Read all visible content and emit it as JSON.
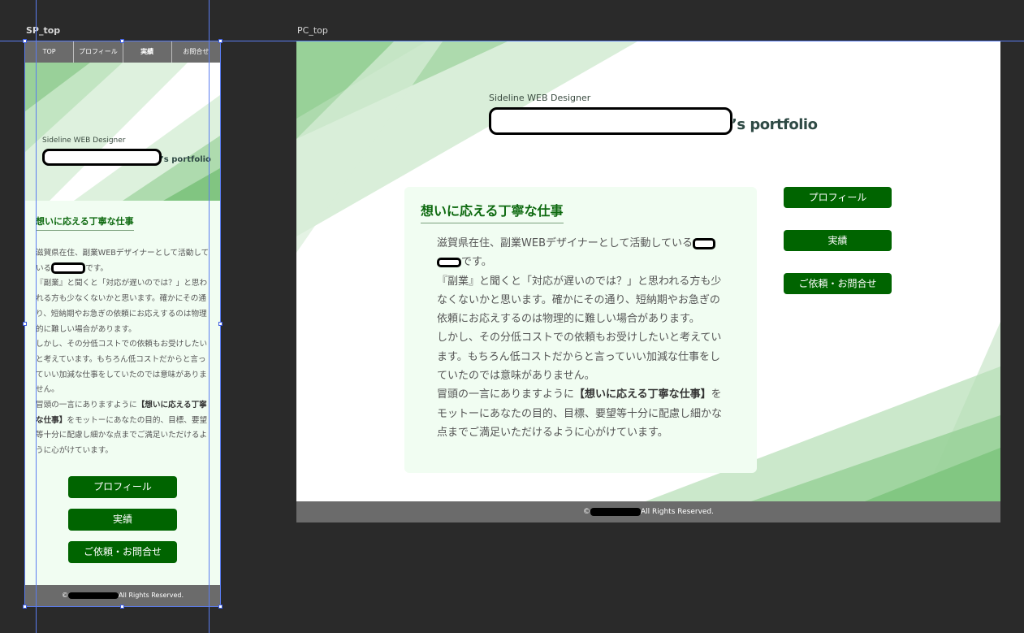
{
  "artboards": {
    "sp_label": "SP_top",
    "pc_label": "PC_top"
  },
  "sp": {
    "nav": [
      "TOP",
      "プロフィール",
      "実績",
      "お問合せ"
    ],
    "tagline": "Sideline WEB Designer",
    "portfolio_suffix": "’s portfolio",
    "heading": "想いに応える丁寧な仕事",
    "body_p1": "滋賀県在住、副業WEBデザイナーとして活動している",
    "body_p1_end": "です。",
    "body_p2": "『副業』と聞くと「対応が遅いのでは？」と思われる方も少なくないかと思います。確かにその通り、短納期やお急ぎの依頼にお応えするのは物理的に難しい場合があります。",
    "body_p3": "しかし、その分低コストでの依頼もお受けしたいと考えています。もちろん低コストだからと言っていい加減な仕事をしていたのでは意味がありません。",
    "body_p4_start": "冒頭の一言にありますように",
    "body_p4_bold": "【想いに応える丁寧な仕事】",
    "body_p4_end": "をモットーにあなたの目的、目標、要望等十分に配慮し細かな点までご満足いただけるように心がけています。",
    "buttons": [
      "プロフィール",
      "実績",
      "ご依頼・お問合せ"
    ],
    "footer_prefix": "©",
    "footer_suffix": "All Rights Reserved."
  },
  "pc": {
    "tagline": "Sideline WEB Designer",
    "portfolio_suffix": "’s portfolio",
    "heading": "想いに応える丁寧な仕事",
    "body_p1": "滋賀県在住、副業WEBデザイナーとして活動している",
    "body_p1_end": "です。",
    "body_p2": "『副業』と聞くと「対応が遅いのでは？」と思われる方も少なくないかと思います。確かにその通り、短納期やお急ぎの依頼にお応えするのは物理的に難しい場合があります。",
    "body_p3": "しかし、その分低コストでの依頼もお受けしたいと考えています。もちろん低コストだからと言っていい加減な仕事をしていたのでは意味がありません。",
    "body_p4_start": "冒頭の一言にありますように",
    "body_p4_bold": "【想いに応える丁寧な仕事】",
    "body_p4_end": "をモットーにあなたの目的、目標、要望等十分に配慮し細かな点までご満足いただけるように心がけています。",
    "buttons": [
      "プロフィール",
      "実績",
      "ご依頼・お問合せ"
    ],
    "footer_prefix": "©",
    "footer_suffix": "All Rights Reserved."
  },
  "colors": {
    "accent": "#006400",
    "heading": "#0e6a10",
    "section_bg": "#f1fdf2",
    "bar_gray": "#6b6b6b",
    "canvas_bg": "#2a2a2a",
    "guide": "#5a7cf0"
  }
}
